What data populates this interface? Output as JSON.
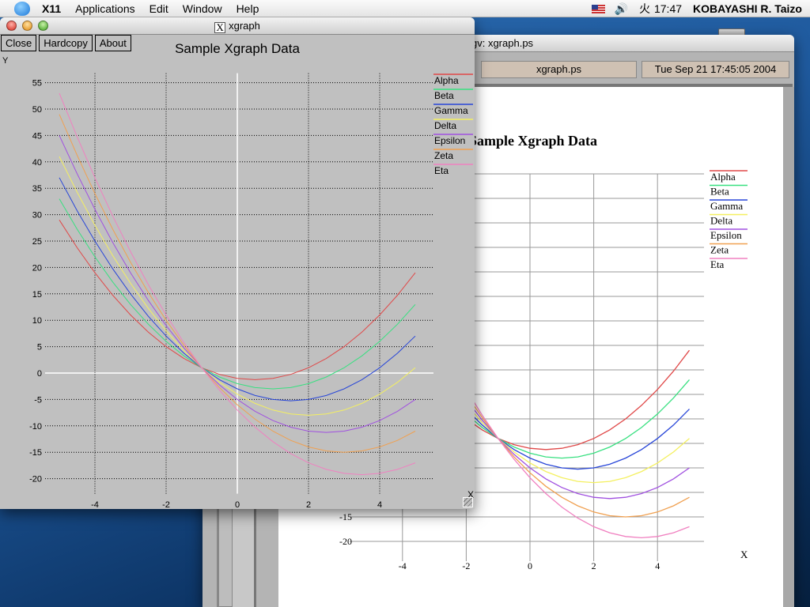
{
  "menubar": {
    "app": "X11",
    "items": [
      "Applications",
      "Edit",
      "Window",
      "Help"
    ],
    "day": "火",
    "time": "17:47",
    "user": "KOBAYASHI R. Taizo"
  },
  "gv_window": {
    "title": "gv: xgraph.ps",
    "file_button": "xgraph.ps",
    "date_button": "Tue Sep 21 17:45:05 2004"
  },
  "xgraph_window": {
    "title": "xgraph",
    "buttons": {
      "close": "Close",
      "hardcopy": "Hardcopy",
      "about": "About"
    }
  },
  "colors": {
    "Alpha": "#e04848",
    "Beta": "#38e080",
    "Gamma": "#2846d8",
    "Delta": "#f4f060",
    "Epsilon": "#a050e0",
    "Zeta": "#f0a050",
    "Eta": "#f080c0"
  },
  "chart_data": {
    "type": "line",
    "title": "Sample Xgraph Data",
    "xlabel": "X",
    "ylabel": "Y",
    "xlim": [
      -5,
      5
    ],
    "ylim": [
      -20,
      55
    ],
    "xticks": [
      -4,
      -2,
      0,
      2,
      4
    ],
    "yticks": [
      -20,
      -15,
      -10,
      -5,
      0,
      5,
      10,
      15,
      20,
      25,
      30,
      35,
      40,
      45,
      50,
      55
    ],
    "grid": true,
    "legend": "right",
    "x": [
      -5,
      -4.5,
      -4,
      -3.5,
      -3,
      -2.5,
      -2,
      -1.5,
      -1,
      -0.5,
      0,
      0.5,
      1,
      1.5,
      2,
      2.5,
      3,
      3.5,
      4,
      4.5,
      5
    ],
    "series": [
      {
        "name": "Alpha",
        "values": [
          29,
          23.75,
          19,
          14.75,
          11,
          7.75,
          5,
          2.75,
          1,
          -0.25,
          -1,
          -1.25,
          -1,
          -0.25,
          1,
          2.75,
          5,
          7.75,
          11,
          14.75,
          19
        ]
      },
      {
        "name": "Beta",
        "values": [
          33,
          27.25,
          22,
          17.25,
          13,
          9.25,
          6,
          3.25,
          1,
          -0.75,
          -2,
          -2.75,
          -3,
          -2.75,
          -2,
          -0.75,
          1,
          3.25,
          6,
          9.25,
          13
        ]
      },
      {
        "name": "Gamma",
        "values": [
          37,
          30.75,
          25,
          19.75,
          15,
          10.75,
          7,
          3.75,
          1,
          -1.25,
          -3,
          -4.25,
          -5,
          -5.25,
          -5,
          -4.25,
          -3,
          -1.25,
          1,
          3.75,
          7
        ]
      },
      {
        "name": "Delta",
        "values": [
          41,
          34.25,
          28,
          22.25,
          17,
          12.25,
          8,
          4.25,
          1,
          -1.75,
          -4,
          -5.75,
          -7,
          -7.75,
          -8,
          -7.75,
          -7,
          -5.75,
          -4,
          -1.75,
          1
        ]
      },
      {
        "name": "Epsilon",
        "values": [
          45,
          37.75,
          31,
          24.75,
          19,
          13.75,
          9,
          4.75,
          1,
          -2.25,
          -5,
          -7.25,
          -9,
          -10.25,
          -11,
          -11.25,
          -11,
          -10.25,
          -9,
          -7.25,
          -5
        ]
      },
      {
        "name": "Zeta",
        "values": [
          49,
          41.25,
          34,
          27.25,
          21,
          15.25,
          10,
          5.25,
          1,
          -2.75,
          -6,
          -8.75,
          -11,
          -12.75,
          -14,
          -14.75,
          -15,
          -14.75,
          -14,
          -12.75,
          -11
        ]
      },
      {
        "name": "Eta",
        "values": [
          53,
          44.75,
          37,
          29.75,
          23,
          16.75,
          11,
          5.75,
          1,
          -3.25,
          -7,
          -10.25,
          -13,
          -15.25,
          -17,
          -18.25,
          -19,
          -19.25,
          -19,
          -18.25,
          -17
        ]
      }
    ]
  }
}
